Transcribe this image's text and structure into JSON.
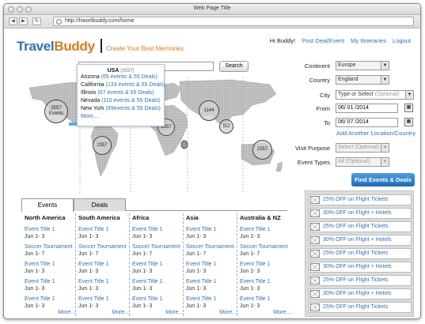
{
  "window": {
    "title": "Web Page Title",
    "url": "http://travelbuddy.com/home"
  },
  "brand": {
    "part1": "Travel",
    "part2": "Buddy",
    "tagline": "Create Your Best Memories"
  },
  "topnav": {
    "greeting": "Hi Buddy!",
    "post": "Post Deal/Event",
    "itineraries": "My Itineraries",
    "logout": "Logout"
  },
  "search": {
    "button": "Search"
  },
  "popup": {
    "country": "USA",
    "count": "(3557)",
    "rows": [
      {
        "state": "Arizona",
        "info": "(65 events & 55 Deals)"
      },
      {
        "state": "California",
        "info": "(133 events & 55 Deals)"
      },
      {
        "state": "Illinois",
        "info": "(67 events & 55 Deals)"
      },
      {
        "state": "Nevada",
        "info": "(110 events & 55 Deals)"
      },
      {
        "state": "New York",
        "info": "(89events & 55 Deals)"
      }
    ],
    "more": "More...."
  },
  "map": {
    "bubbles": [
      {
        "label": "3557",
        "sub": "Events"
      },
      {
        "label": "1144"
      },
      {
        "label": "2657"
      },
      {
        "label": "112"
      },
      {
        "label": "2357"
      },
      {
        "label": "2357"
      }
    ]
  },
  "form": {
    "continent_label": "Continent",
    "continent": "Europe",
    "country_label": "Country",
    "country": "England",
    "city_label": "City",
    "city": "Type or Select",
    "city_hint": "(Optional)",
    "from_label": "From",
    "from": "06/ 01 /2014",
    "to_label": "To",
    "to": "06/ 07 /2014",
    "add_location": "Add Another Location/Country",
    "purpose_label": "Visit Purpose",
    "purpose": "Select (Optional)",
    "types_label": "Event Types",
    "types": "All (Optional)",
    "find_button": "Find Events & Deals"
  },
  "tabs": {
    "events": "Events",
    "deals": "Deals"
  },
  "regions": [
    {
      "name": "North America",
      "events": [
        {
          "title": "Event Title 1",
          "date": "Jun 1- 3"
        },
        {
          "title": "Soccer Tournament",
          "date": "Jun 1- 7"
        },
        {
          "title": "Event Title 1",
          "date": "Jun 1- 3"
        },
        {
          "title": "Event Title 1",
          "date": "Jun 1- 3"
        },
        {
          "title": "Event Title 1",
          "date": "Jun 1- 3"
        }
      ],
      "more": "More...."
    },
    {
      "name": "South America",
      "events": [
        {
          "title": "Event Title 1",
          "date": "Jun 1- 3"
        },
        {
          "title": "Soccer Tournament",
          "date": "Jun 1- 7"
        },
        {
          "title": "Event Title 1",
          "date": "Jun 1- 3"
        },
        {
          "title": "Event Title 1",
          "date": "Jun 1- 3"
        },
        {
          "title": "Event Title 1",
          "date": "Jun 1- 3"
        }
      ],
      "more": "More...."
    },
    {
      "name": "Africa",
      "events": [
        {
          "title": "Event Title 1",
          "date": "Jun 1- 3"
        },
        {
          "title": "Soccer Tournament",
          "date": "Jun 1- 7"
        },
        {
          "title": "Event Title 1",
          "date": "Jun 1- 3"
        },
        {
          "title": "Event Title 1",
          "date": "Jun 1- 3"
        },
        {
          "title": "Event Title 1",
          "date": "Jun 1- 3"
        }
      ],
      "more": "More...."
    },
    {
      "name": "Asia",
      "events": [
        {
          "title": "Event Title 1",
          "date": "Jun 1- 3"
        },
        {
          "title": "Soccer Tournament",
          "date": "Jun 1- 7"
        },
        {
          "title": "Event Title 1",
          "date": "Jun 1- 3"
        },
        {
          "title": "Event Title 1",
          "date": "Jun 1- 3"
        },
        {
          "title": "Event Title 1",
          "date": "Jun 1- 3"
        }
      ],
      "more": "More...."
    },
    {
      "name": "Australia & NZ",
      "events": [
        {
          "title": "Event Title 1",
          "date": "Jun 1- 3"
        },
        {
          "title": "Soccer Tournament",
          "date": "Jun 1- 7"
        },
        {
          "title": "Event Title 1",
          "date": "Jun 1- 3"
        },
        {
          "title": "Event Title 1",
          "date": "Jun 1- 3"
        },
        {
          "title": "Event Title 1",
          "date": "Jun 1- 3"
        }
      ],
      "more": "More...."
    }
  ],
  "deals": [
    "25% OFF on Flight Tickets",
    "30% OFF on Flight + Hotels",
    "25% OFF on Flight Tickets",
    "30% OFF on Flight + Hotels",
    "25% OFF on Flight Tickets",
    "30% OFF on Flight + Hotels",
    "25% OFF on Flight Tickets",
    "30% OFF on Flight + Hotels",
    "25% OFF on Flight Tickets"
  ]
}
